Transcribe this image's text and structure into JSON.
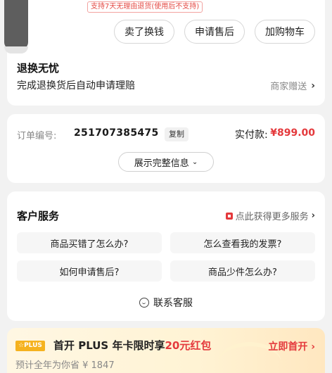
{
  "product_card": {
    "return_tag": "支持7天无理由退货(使用后不支持)",
    "actions": [
      "卖了换钱",
      "申请售后",
      "加购物车"
    ],
    "section_title": "退换无忧",
    "section_desc": "完成退换货后自动申请理赔",
    "merchant_gift": "商家赠送"
  },
  "order": {
    "number_label": "订单编号:",
    "number": "251707385475",
    "copy_label": "复制",
    "paid_label": "实付款:",
    "paid_amount": "¥899.00",
    "expand_label": "展示完整信息"
  },
  "service": {
    "title": "客户服务",
    "more_label": "点此获得更多服务",
    "questions": [
      "商品买错了怎么办?",
      "怎么查看我的发票?",
      "如何申请售后?",
      "商品少件怎么办?"
    ],
    "contact_label": "联系客服"
  },
  "plus": {
    "badge": "☆PLUS",
    "title_prefix": "首开 PLUS 年卡限时享",
    "title_highlight": "20元红包",
    "open_label": "立即首开",
    "subtitle": "预计全年为你省 ¥ 1847"
  },
  "colors": {
    "accent_red": "#e4393c",
    "plus_gold": "#f5b21f",
    "background": "#f2f2f2"
  },
  "icons": [
    "chevron-right-icon",
    "chevron-down-icon",
    "service-flag-icon",
    "customer-service-icon"
  ]
}
